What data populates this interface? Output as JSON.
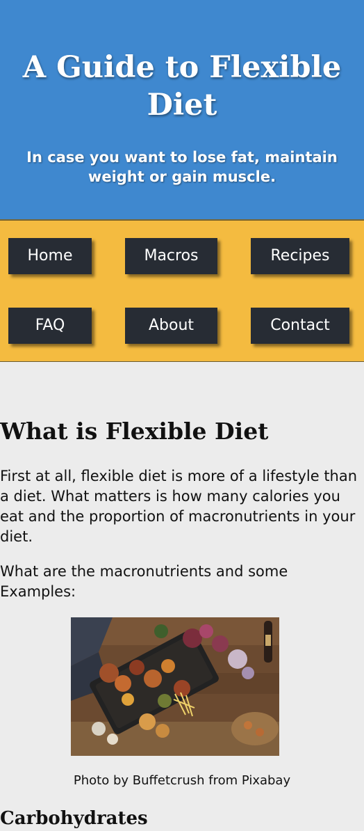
{
  "header": {
    "title": "A Guide to Flexible Diet",
    "tagline": "In case you want to lose fat, maintain weight or gain muscle."
  },
  "nav": {
    "items": [
      {
        "label": "Home"
      },
      {
        "label": "Macros"
      },
      {
        "label": "Recipes"
      },
      {
        "label": "FAQ"
      },
      {
        "label": "About"
      },
      {
        "label": "Contact"
      }
    ]
  },
  "main": {
    "heading": "What is Flexible Diet",
    "paragraph1": "First at all, flexible diet is more of a lifestyle than a diet. What matters is how many calories you eat and the proportion of macronutrients in your diet.",
    "paragraph2": "What are the macronutrients and some Examples:",
    "image_caption": "Photo by Buffetcrush from Pixabay",
    "subheading": "Carbohydrates"
  },
  "colors": {
    "header_bg": "#3f88cf",
    "nav_bg": "#f4bb40",
    "button_bg": "#272c34",
    "page_bg": "#ececec"
  }
}
